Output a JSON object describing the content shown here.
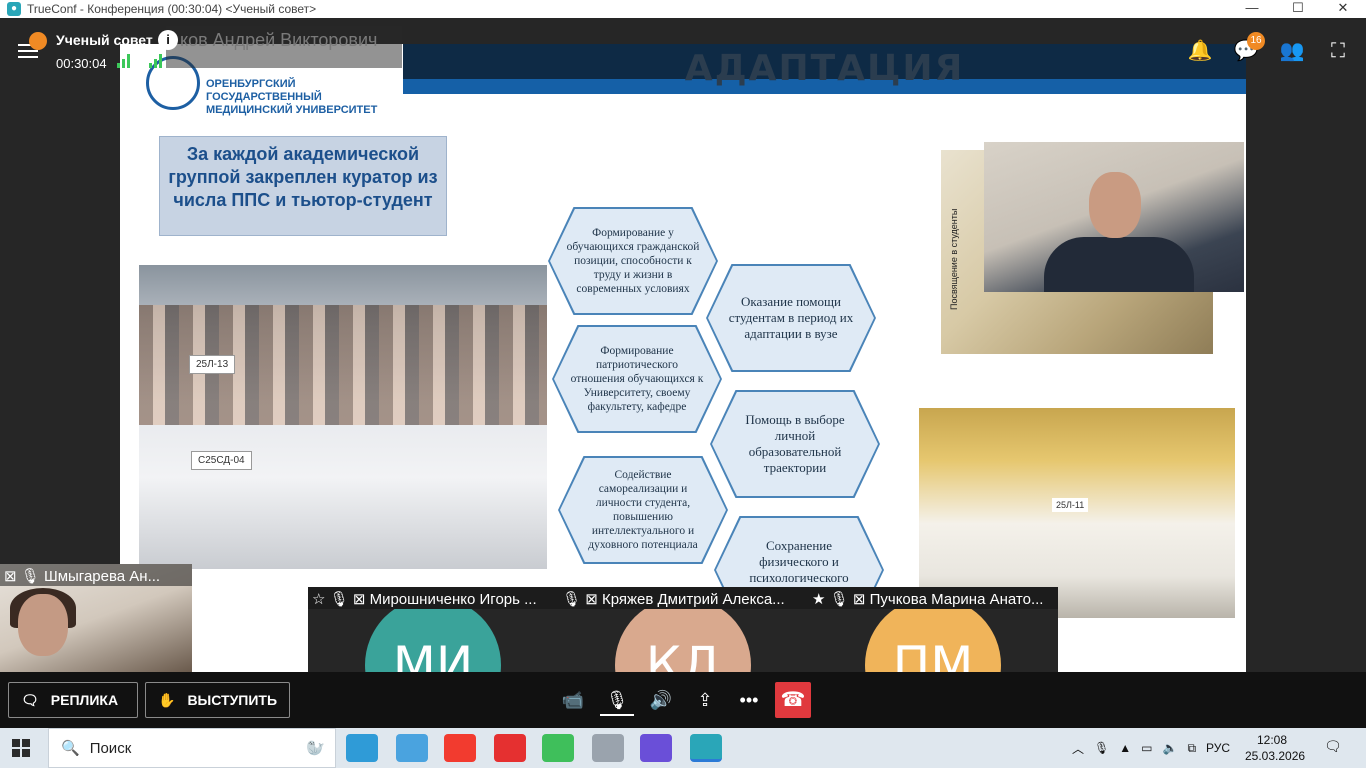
{
  "window": {
    "title": "TrueConf - Конференция (00:30:04) <Ученый совет>",
    "controls": {
      "minimize": "—",
      "maximize": "☐",
      "close": "✕"
    }
  },
  "conference": {
    "name": "Ученый совет",
    "timer": "00:30:04",
    "speaker_label": "ков Андрей Викторович",
    "chat_badge": "16"
  },
  "slide": {
    "title": "АДАПТАЦИЯ",
    "university": "ОРЕНБУРГСКИЙ ГОСУДАРСТВЕННЫЙ МЕДИЦИНСКИЙ УНИВЕРСИТЕТ",
    "curator_text": "За каждой академической группой закреплен куратор из числа ППС и тьютор-студент",
    "photo1_signs": [
      "25Л-13",
      "С25СД-04"
    ],
    "photo2_label": "Посвящение в студенты",
    "photo3_sign": "25Л-11",
    "hexagons": [
      "Формирование у обучающихся гражданской позиции, способности к труду и жизни в современных условиях",
      "Формирование патриотического отношения обучающихся к Университету, своему факультету, кафедре",
      "Содействие самореализации и личности студента, повышению интеллектуального и духовного потенциала",
      "Оказание помощи студентам в период их адаптации в вузе",
      "Помощь в выборе личной образовательной траектории",
      "Сохранение физического и психологического здоровья студентов"
    ]
  },
  "participants": {
    "self": {
      "name": "Шмыгарева Ан..."
    },
    "tiles": [
      {
        "name": "Мирошниченко Игорь ...",
        "initials": "МИ",
        "color": "#3aa39a"
      },
      {
        "name": "Кряжев Дмитрий Алекса...",
        "initials": "КД",
        "color": "#d9a98e"
      },
      {
        "name": "Пучкова Марина Анато...",
        "initials": "ПМ",
        "color": "#f0b45a"
      }
    ]
  },
  "controls": {
    "replica_label": "РЕПЛИКА",
    "speak_label": "ВЫСТУПИТЬ"
  },
  "taskbar": {
    "search_placeholder": "Поиск",
    "language": "РУС",
    "time": "12:08",
    "date": "25.03.2026"
  }
}
